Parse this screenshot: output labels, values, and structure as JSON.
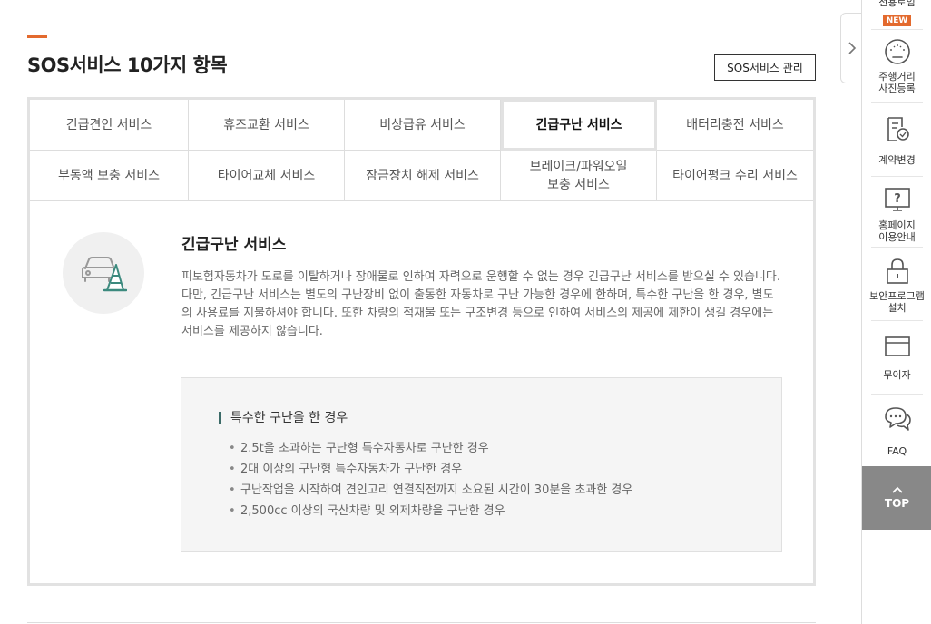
{
  "section": {
    "title": "SOS서비스 10가지 항목",
    "manage_button": "SOS서비스 관리"
  },
  "tabs": [
    {
      "label": "긴급견인 서비스",
      "active": false
    },
    {
      "label": "휴즈교환 서비스",
      "active": false
    },
    {
      "label": "비상급유 서비스",
      "active": false
    },
    {
      "label": "긴급구난 서비스",
      "active": true
    },
    {
      "label": "배터리충전 서비스",
      "active": false
    },
    {
      "label": "부동액 보충 서비스",
      "active": false
    },
    {
      "label": "타이어교체 서비스",
      "active": false
    },
    {
      "label": "잠금장치 해제 서비스",
      "active": false
    },
    {
      "label": "브레이크/파워오일\n보충 서비스",
      "active": false
    },
    {
      "label": "타이어펑크 수리 서비스",
      "active": false
    }
  ],
  "content": {
    "title": "긴급구난 서비스",
    "description": "피보험자동차가 도로를 이탈하거나 장애물로 인하여 자력으로 운행할 수 없는 경우 긴급구난 서비스를 받으실 수 있습니다. 다만, 긴급구난 서비스는 별도의 구난장비 없이 출동한 자동차로 구난 가능한 경우에 한하며, 특수한 구난을 한 경우, 별도의 사용료를 지불하셔야 합니다. 또한 차량의 적재물 또는 구조변경 등으로 인하여 서비스의 제공에 제한이 생길 경우에는 서비스를 제공하지 않습니다.",
    "icon": "car-cone-icon"
  },
  "note": {
    "title": "특수한 구난을 한 경우",
    "items": [
      "2.5t을 초과하는 구난형 특수자동차로 구난한 경우",
      "2대 이상의 구난형 특수자동차가 구난한 경우",
      "구난작업을 시작하여 견인고리 연결직전까지 소요된 시간이 30분을 초과한 경우",
      "2,500cc 이상의 국산차량 및 외제차량을 구난한 경우"
    ]
  },
  "sidebar": {
    "top_partial_label": "전용로임",
    "new_badge": "NEW",
    "items": [
      {
        "label": "주행거리\n사진등록",
        "icon": "speedometer-icon"
      },
      {
        "label": "계약변경",
        "icon": "document-check-icon"
      },
      {
        "label": "홈페이지\n이용안내",
        "icon": "question-monitor-icon"
      },
      {
        "label": "보안프로그램\n설치",
        "icon": "lock-icon"
      },
      {
        "label": "무이자",
        "icon": "card-icon"
      },
      {
        "label": "FAQ",
        "icon": "chat-bubbles-icon"
      }
    ],
    "top_button": "TOP"
  },
  "colors": {
    "accent": "#e36a2e",
    "note_marker": "#3c6b68",
    "top_button_bg": "#888888"
  }
}
